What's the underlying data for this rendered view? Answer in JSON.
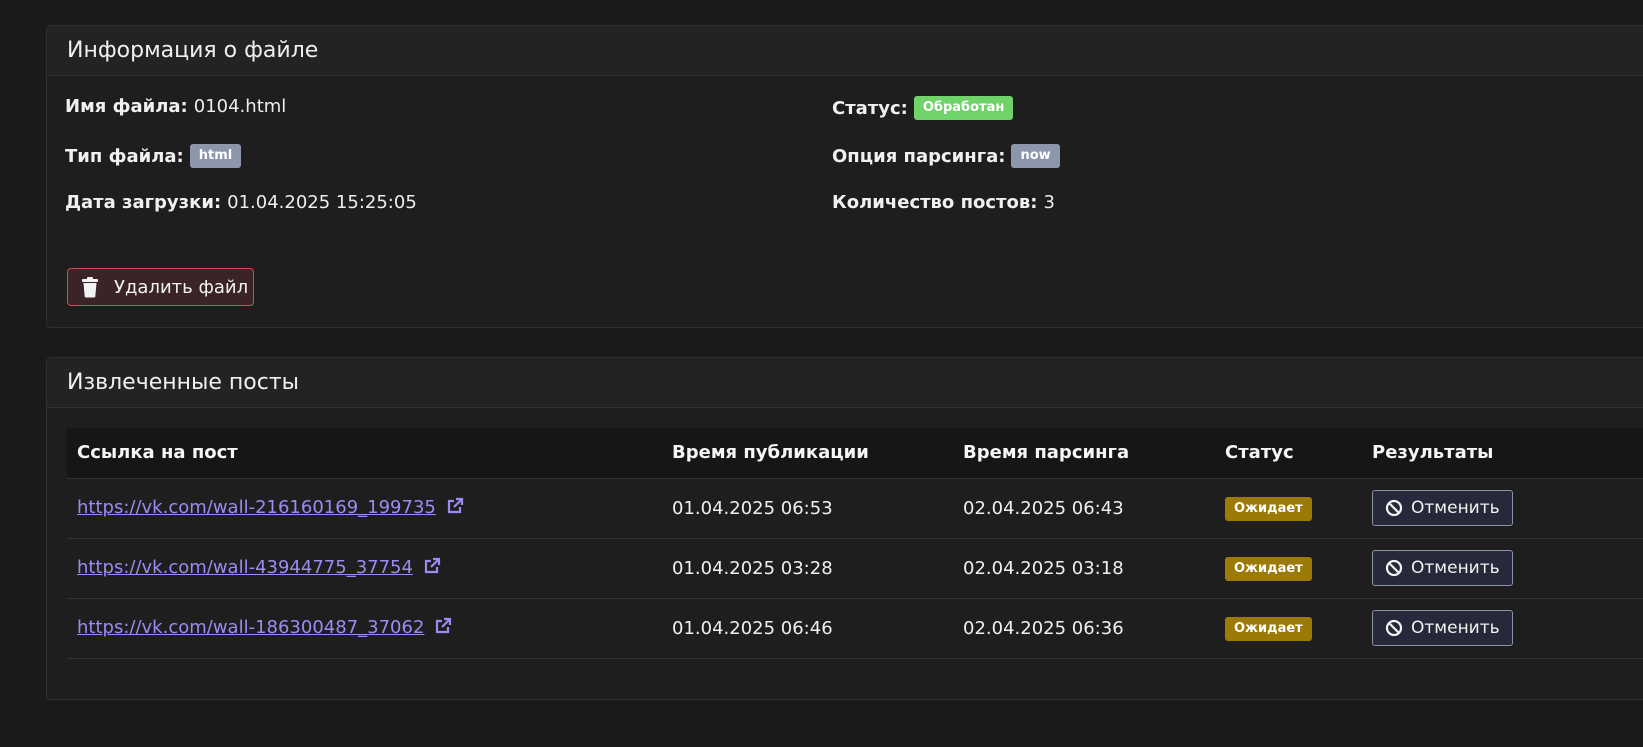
{
  "file_info": {
    "title": "Информация о файле",
    "file_name_label": "Имя файла:",
    "file_name": "0104.html",
    "file_type_label": "Тип файла:",
    "file_type": "html",
    "upload_date_label": "Дата загрузки:",
    "upload_date": "01.04.2025 15:25:05",
    "status_label": "Статус:",
    "status": "Обработан",
    "parse_option_label": "Опция парсинга:",
    "parse_option": "now",
    "posts_count_label": "Количество постов:",
    "posts_count": "3",
    "delete_button": "Удалить файл"
  },
  "posts": {
    "title": "Извлеченные посты",
    "columns": [
      "Ссылка на пост",
      "Время публикации",
      "Время парсинга",
      "Статус",
      "Результаты"
    ],
    "rows": [
      {
        "link": "https://vk.com/wall-216160169_199735",
        "published": "01.04.2025 06:53",
        "parsed": "02.04.2025 06:43",
        "status": "Ожидает",
        "action": "Отменить"
      },
      {
        "link": "https://vk.com/wall-43944775_37754",
        "published": "01.04.2025 03:28",
        "parsed": "02.04.2025 03:18",
        "status": "Ожидает",
        "action": "Отменить"
      },
      {
        "link": "https://vk.com/wall-186300487_37062",
        "published": "01.04.2025 06:46",
        "parsed": "02.04.2025 06:36",
        "status": "Ожидает",
        "action": "Отменить"
      }
    ]
  },
  "icons": {
    "delete": "trash-icon",
    "external": "external-link-icon",
    "cancel": "ban-icon"
  },
  "colors": {
    "status_done": "#6fd36a",
    "badge_grey": "#8d97ab",
    "status_waiting": "#9c7a08",
    "link": "#9b8cf5",
    "danger": "#d14a55"
  }
}
